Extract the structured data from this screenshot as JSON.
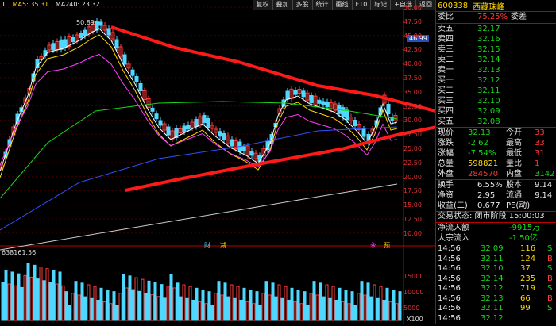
{
  "top": {
    "ma_legend": [
      "1",
      "MA5: 35.31",
      "MA240: 23.32"
    ],
    "peak_label": "50.89",
    "toolbar": [
      "复权",
      "叠加",
      "多股",
      "统计",
      "画线",
      "F10",
      "标记",
      "+自选",
      "返回"
    ]
  },
  "axis": {
    "price_ticks": [
      "50.00",
      "47.50",
      "45.00",
      "42.50",
      "40.00",
      "37.50",
      "35.00",
      "32.50",
      "30.00",
      "27.50",
      "25.00",
      "22.50",
      "20.00",
      "17.50",
      "15.00",
      "12.50",
      "10.00"
    ],
    "volume_ticks": [
      "15000",
      "10000",
      "5000"
    ],
    "price_tag": "46.99",
    "volume_label": "638161.56",
    "volume_unit": "X100"
  },
  "chart_marks": {
    "left_labels": [
      "财",
      "减"
    ],
    "right_labels": [
      "永",
      "预"
    ]
  },
  "colors": {
    "up": "#ff3a3a",
    "down": "#4fd8ff",
    "trend": "#ff1a1a",
    "ma5": "#ffffff",
    "ma10": "#ffd800",
    "ma20": "#ff40ff",
    "ma60": "#18d818",
    "ma120": "#3050ff",
    "ma240": "#cccccc"
  },
  "quote": {
    "code": "600338",
    "name": "西藏珠峰",
    "weibi_label": "委比",
    "weibi_value": "75.25%",
    "weicha_label": "委差",
    "sells": [
      {
        "label": "卖五",
        "price": "32.17",
        "vol": ""
      },
      {
        "label": "卖四",
        "price": "32.16",
        "vol": ""
      },
      {
        "label": "卖三",
        "price": "32.15",
        "vol": ""
      },
      {
        "label": "卖二",
        "price": "32.14",
        "vol": ""
      },
      {
        "label": "卖一",
        "price": "32.13",
        "vol": ""
      }
    ],
    "buys": [
      {
        "label": "买一",
        "price": "32.12",
        "vol": ""
      },
      {
        "label": "买二",
        "price": "32.11",
        "vol": ""
      },
      {
        "label": "买三",
        "price": "32.10",
        "vol": ""
      },
      {
        "label": "买四",
        "price": "32.09",
        "vol": ""
      },
      {
        "label": "买五",
        "price": "32.08",
        "vol": ""
      }
    ],
    "stats": [
      {
        "l1": "现价",
        "v1": "32.13",
        "l2": "今开",
        "v2": "33"
      },
      {
        "l1": "涨跌",
        "v1": "-2.62",
        "l2": "最高",
        "v2": "33"
      },
      {
        "l1": "涨幅",
        "v1": "-7.54%",
        "l2": "最低",
        "v2": "31"
      },
      {
        "l1": "总量",
        "v1": "598821",
        "l2": "量比",
        "v2": "1"
      },
      {
        "l1": "外盘",
        "v1": "284570",
        "l2": "内盘",
        "v2": "3142"
      }
    ],
    "stats2": [
      {
        "l1": "换手",
        "v1": "6.55%",
        "l2": "股本",
        "v2": "9.14"
      },
      {
        "l1": "净资",
        "v1": "2.95",
        "l2": "流通",
        "v2": "9.14"
      },
      {
        "l1": "收益(二)",
        "v1": "0.677",
        "l2": "PE(动)",
        "v2": ""
      }
    ],
    "status": "交易状态: 闭市阶段 15:00:03",
    "flows": [
      {
        "label": "净流入额",
        "value": "-9915万"
      },
      {
        "label": "大宗流入",
        "value": "-1.50亿"
      }
    ],
    "ticks": [
      {
        "time": "14:56",
        "price": "32.09",
        "vol": "116",
        "dir": "S"
      },
      {
        "time": "14:56",
        "price": "32.11",
        "vol": "124",
        "dir": "B"
      },
      {
        "time": "14:56",
        "price": "32.10",
        "vol": "37",
        "dir": "S"
      },
      {
        "time": "14:56",
        "price": "32.14",
        "vol": "235",
        "dir": "B"
      },
      {
        "time": "14:56",
        "price": "32.12",
        "vol": "719",
        "dir": "S"
      },
      {
        "time": "14:56",
        "price": "32.13",
        "vol": "66",
        "dir": "B"
      },
      {
        "time": "14:56",
        "price": "32.11",
        "vol": "99",
        "dir": "S"
      },
      {
        "time": "14:56",
        "price": "32.12",
        "vol": "",
        "dir": ""
      }
    ]
  }
}
